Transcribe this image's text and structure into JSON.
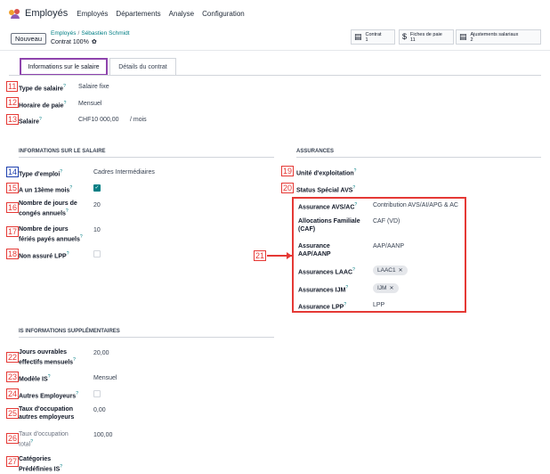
{
  "nav": {
    "app_name": "Employés",
    "menu": [
      "Employés",
      "Départements",
      "Analyse",
      "Configuration"
    ]
  },
  "control": {
    "new_button": "Nouveau",
    "breadcrumb_parent": "Employés",
    "breadcrumb_sep": "/",
    "breadcrumb_current": "Sébastien Schmidt",
    "record_title": "Contrat 100%",
    "smart_buttons": [
      {
        "icon": "contract-icon",
        "label": "Contrat",
        "count": "1"
      },
      {
        "icon": "dollar-icon",
        "label": "Fiches de paie",
        "count": "11"
      },
      {
        "icon": "book-icon",
        "label": "Ajustements salariaux",
        "count": "2"
      }
    ]
  },
  "tabs": [
    "Informations sur le salaire",
    "Détails du contrat"
  ],
  "top_fields": [
    {
      "num": "11",
      "label": "Type de salaire",
      "value": "Salaire fixe"
    },
    {
      "num": "12",
      "label": "Horaire de paie",
      "value": "Mensuel"
    },
    {
      "num": "13",
      "label": "Salaire",
      "value": "CHF10 000,00",
      "suffix": "/ mois"
    }
  ],
  "salary_info": {
    "title": "INFORMATIONS SUR LE SALAIRE",
    "fields": [
      {
        "num": "14",
        "label": "Type d'emploi",
        "value": "Cadres Intermédiaires"
      },
      {
        "num": "15",
        "label": "A un 13ème mois",
        "checked": true
      },
      {
        "num": "16",
        "label_l1": "Nombre de jours de",
        "label_l2": "congés annuels",
        "value": "20"
      },
      {
        "num": "17",
        "label_l1": "Nombre de jours",
        "label_l2": "fériés payés annuels",
        "value": "10"
      },
      {
        "num": "18",
        "label": "Non assuré LPP",
        "checked": false
      }
    ]
  },
  "insurance": {
    "title": "ASSURANCES",
    "fields": [
      {
        "num": "19",
        "label": "Unité d'exploitation"
      },
      {
        "num": "20",
        "label": "Status Spécial AVS"
      }
    ],
    "box_num": "21",
    "boxed": [
      {
        "label": "Assurance AVS/AC",
        "value": "Contribution AVS/AI/APG & AC"
      },
      {
        "label_l1": "Allocations Familiale",
        "label_l2": "(CAF)",
        "value": "CAF (VD)"
      },
      {
        "label_l1": "Assurance",
        "label_l2": "AAP/AANP",
        "value": "AAP/AANP"
      },
      {
        "label": "Assurances LAAC",
        "tag": "LAAC1"
      },
      {
        "label": "Assurances IJM",
        "tag": "IJM"
      },
      {
        "label": "Assurance LPP",
        "value": "LPP"
      }
    ]
  },
  "is_info": {
    "title": "IS INFORMATIONS SUPPLÉMENTAIRES",
    "fields": [
      {
        "num": "22",
        "label_l1": "Jours ouvrables",
        "label_l2": "effectifs mensuels",
        "value": "20,00"
      },
      {
        "num": "23",
        "label": "Modèle IS",
        "value": "Mensuel"
      },
      {
        "num": "24",
        "label": "Autres Employeurs",
        "checked": false
      },
      {
        "num": "25",
        "label_l1": "Taux d'occupation",
        "label_l2": "autres employeurs",
        "value": "0,00"
      },
      {
        "num": "26",
        "label_l1": "Taux d'occupation",
        "label_l2": "total",
        "value": "100,00"
      },
      {
        "num": "27",
        "label_l1": "Catégories",
        "label_l2": "Prédéfinies IS"
      }
    ]
  },
  "help_mark": "?"
}
